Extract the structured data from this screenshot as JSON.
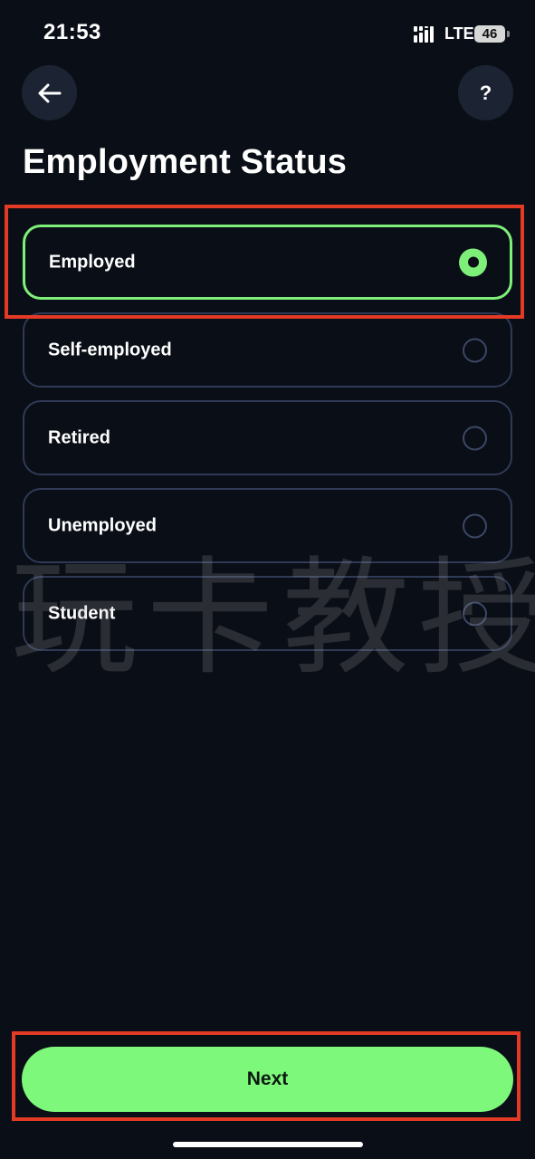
{
  "status_bar": {
    "time": "21:53",
    "network": "LTE",
    "battery": "46",
    "signal_icon": "signal-bars-icon"
  },
  "nav": {
    "back_icon": "arrow-left-icon",
    "help_label": "?"
  },
  "page": {
    "title": "Employment Status"
  },
  "options": [
    {
      "label": "Employed",
      "selected": true
    },
    {
      "label": "Self-employed",
      "selected": false
    },
    {
      "label": "Retired",
      "selected": false
    },
    {
      "label": "Unemployed",
      "selected": false
    },
    {
      "label": "Student",
      "selected": false
    }
  ],
  "watermark": "玩卡教授",
  "footer": {
    "next_label": "Next"
  },
  "colors": {
    "background": "#0a0e16",
    "accent": "#7ef07a",
    "border": "#2f3a56",
    "highlight": "#e23a25"
  }
}
